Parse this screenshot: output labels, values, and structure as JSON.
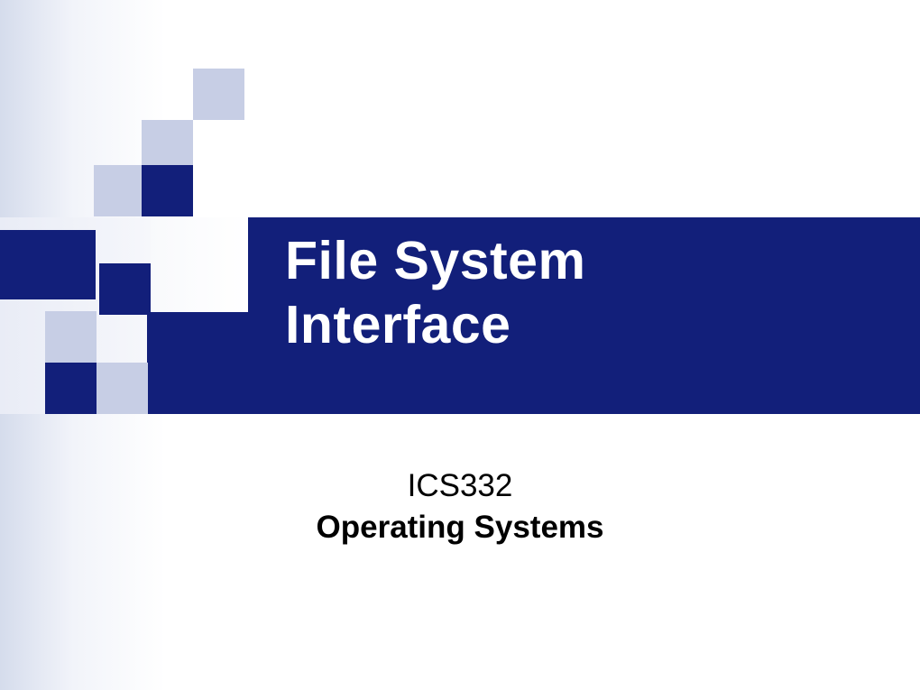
{
  "slide": {
    "title_line1": "File System",
    "title_line2": "Interface",
    "subtitle_line1": "ICS332",
    "subtitle_line2": "Operating Systems"
  },
  "colors": {
    "dark_blue": "#121f7a",
    "light_blue": "#c7cee5",
    "background_gradient_start": "#d5dcec",
    "background_gradient_end": "#ffffff"
  }
}
